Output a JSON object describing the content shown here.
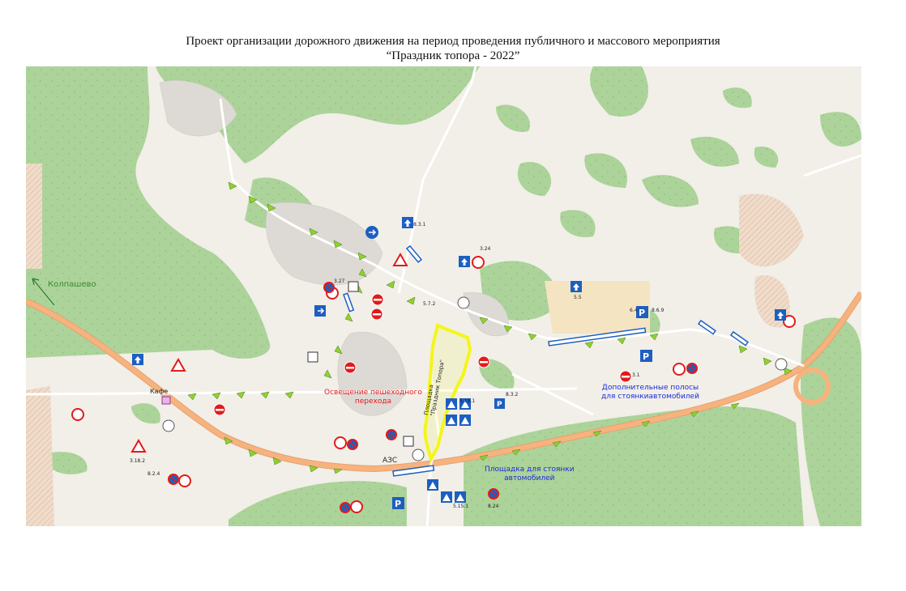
{
  "title": {
    "line1": "Проект организации дорожного движения на период проведения публичного и массового мероприятия",
    "line2": "“Праздник топора - 2022”"
  },
  "map": {
    "labels": {
      "direction_kolpashevo": "Колпашево",
      "pedestrian_lighting": "Освещение пешеходного\nперехода",
      "extra_lanes": "Дополнительные  полосы\nдля стоянкиавтомобилей",
      "parking_area": "Площадка для стоянки\nавтомобилей",
      "venue": "Площадка\n\"Праздник Топора\"",
      "gas_station": "АЗС",
      "cafe": "Кафе"
    },
    "sign_codes": [
      "3.24",
      "3.27",
      "6.4",
      "8.2.4",
      "8.3.1",
      "5.5",
      "5.19.1",
      "8.6.9",
      "8.3.2",
      "3.1",
      "8.24",
      "3.18.2",
      "5.15.1",
      "5.7.2"
    ],
    "colors": {
      "map_background": "#f1efe8",
      "forest": "#acd39a",
      "highway": "#f6b37e",
      "venue_outline": "#f5f51a",
      "sign_blue": "#1d5fc1",
      "sign_red": "#e21b1b",
      "route_arrow": "#8fd12f",
      "label_blue": "#1c2bd8",
      "label_red": "#e21b1b"
    },
    "icons": [
      "sign-no-entry-icon",
      "sign-parking-icon",
      "sign-speed-limit-icon",
      "sign-no-stopping-icon",
      "sign-one-way-icon",
      "sign-detour-arrow-icon",
      "sign-warning-triangle-icon"
    ]
  }
}
